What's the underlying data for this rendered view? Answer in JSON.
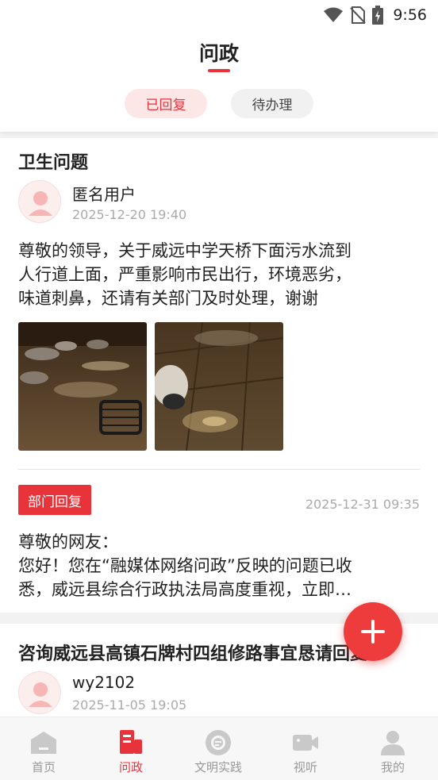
{
  "status_bar": {
    "time": "9:56"
  },
  "header": {
    "title": "问政"
  },
  "tabs": [
    {
      "label": "已回复",
      "active": true
    },
    {
      "label": "待办理",
      "active": false
    }
  ],
  "posts": [
    {
      "title": "卫生问题",
      "user": "匿名用户",
      "time": "2025-12-20 19:40",
      "content_lines": [
        "尊敬的领导，关于威远中学天桥下面污水流到",
        "人行道上面，严重影响市民出行，环境恶劣，",
        "味道刺鼻，还请有关部门及时处理，谢谢"
      ],
      "reply": {
        "badge": "部门回复",
        "time": "2025-12-31 09:35",
        "content_lines": [
          "尊敬的网友：",
          "您好！您在“融媒体网络问政”反映的问题已收",
          "悉，威远县综合行政执法局高度重视，立即…"
        ]
      }
    },
    {
      "title": "咨询威远县高镇石牌村四组修路事宜恳请回复",
      "user": "wy2102",
      "time": "2025-11-05 19:05"
    }
  ],
  "bottom_nav": [
    {
      "label": "首页",
      "icon": "home-icon",
      "active": false
    },
    {
      "label": "问政",
      "icon": "wenzheng-icon",
      "active": true
    },
    {
      "label": "文明实践",
      "icon": "civilization-icon",
      "active": false
    },
    {
      "label": "视听",
      "icon": "video-icon",
      "active": false
    },
    {
      "label": "我的",
      "icon": "profile-icon",
      "active": false
    }
  ],
  "colors": {
    "accent": "#e8333a",
    "inactive": "#999999"
  }
}
